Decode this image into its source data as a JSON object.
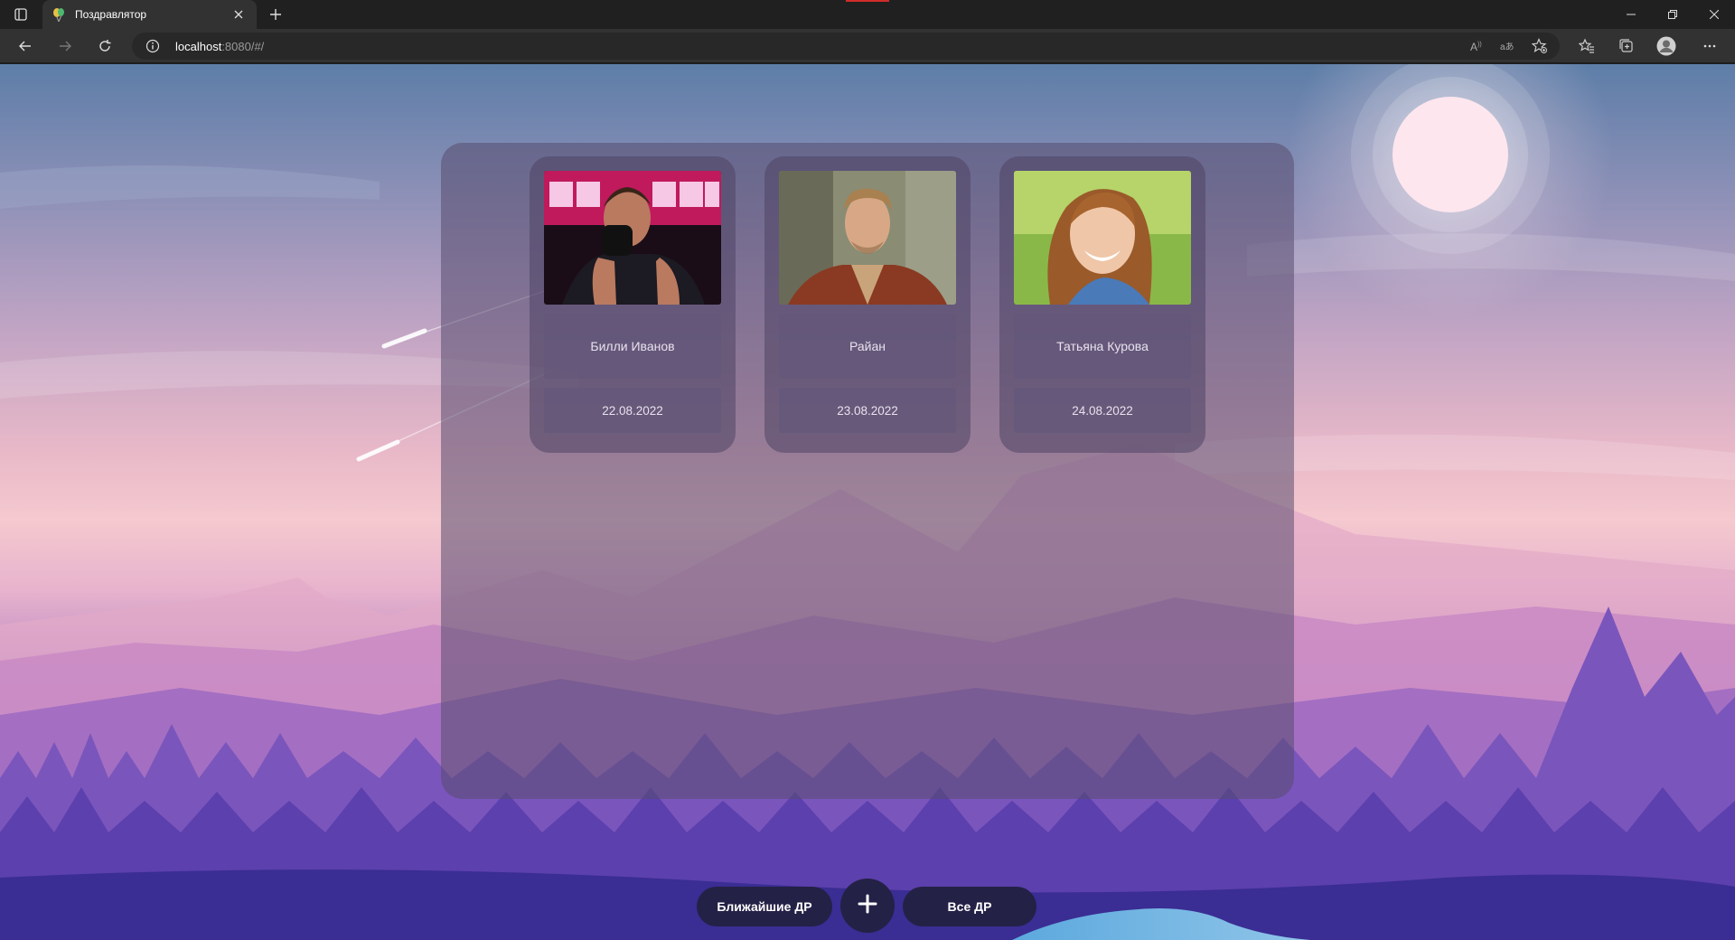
{
  "browser": {
    "tab_title": "Поздравлятор",
    "url_host": "localhost",
    "url_rest": ":8080/#/"
  },
  "cards": [
    {
      "name": "Билли Иванов",
      "date": "22.08.2022"
    },
    {
      "name": "Райан",
      "date": "23.08.2022"
    },
    {
      "name": "Татьяна Курова",
      "date": "24.08.2022"
    }
  ],
  "nav": {
    "upcoming_label": "Ближайшие ДР",
    "all_label": "Все ДР"
  },
  "icons": {
    "add": "plus-icon"
  },
  "colors": {
    "button_bg": "#242146",
    "panel_bg": "#584c70"
  }
}
